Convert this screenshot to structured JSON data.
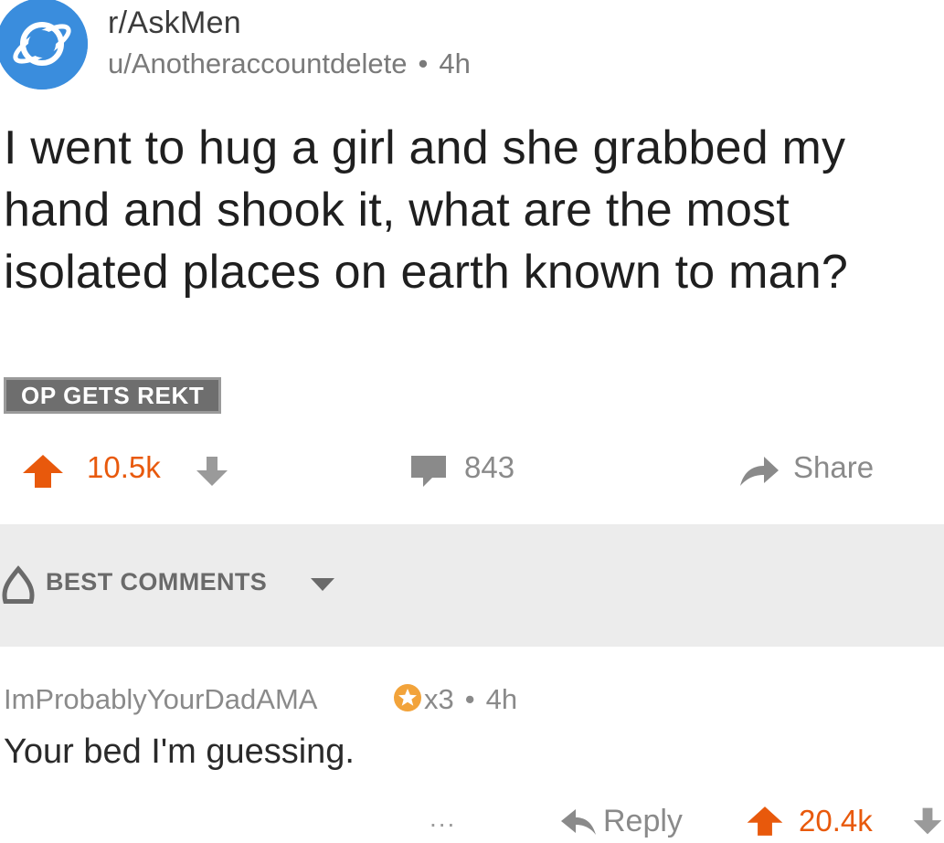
{
  "post": {
    "subreddit": "r/AskMen",
    "author": "u/Anotheraccountdelete",
    "age": "4h",
    "title": "I went to hug a girl and she grabbed my hand and shook it, what are the most isolated places on earth known to man?",
    "flair": "OP GETS REKT",
    "score": "10.5k",
    "comment_count": "843",
    "share_label": "Share"
  },
  "sort": {
    "label": "BEST COMMENTS"
  },
  "comment": {
    "author": "ImProbablyYourDadAMA",
    "award_count": "x3",
    "age": "4h",
    "body": "Your bed I'm guessing.",
    "more": "...",
    "reply_label": "Reply",
    "score": "20.4k"
  },
  "colors": {
    "upvote": "#e8590c",
    "subreddit_avatar": "#3a8ddd",
    "sort_bar": "#ececec",
    "flair_bg": "#6e6e6e",
    "award": "#f2a33a"
  },
  "icons": {
    "subreddit": "planet-icon",
    "upvote": "arrow-up-icon",
    "downvote": "arrow-down-icon",
    "comments": "speech-bubble-icon",
    "share": "share-arrow-icon",
    "sort": "flame-icon",
    "dropdown": "chevron-down-icon",
    "award": "silver-award-icon",
    "reply": "reply-arrow-icon"
  }
}
